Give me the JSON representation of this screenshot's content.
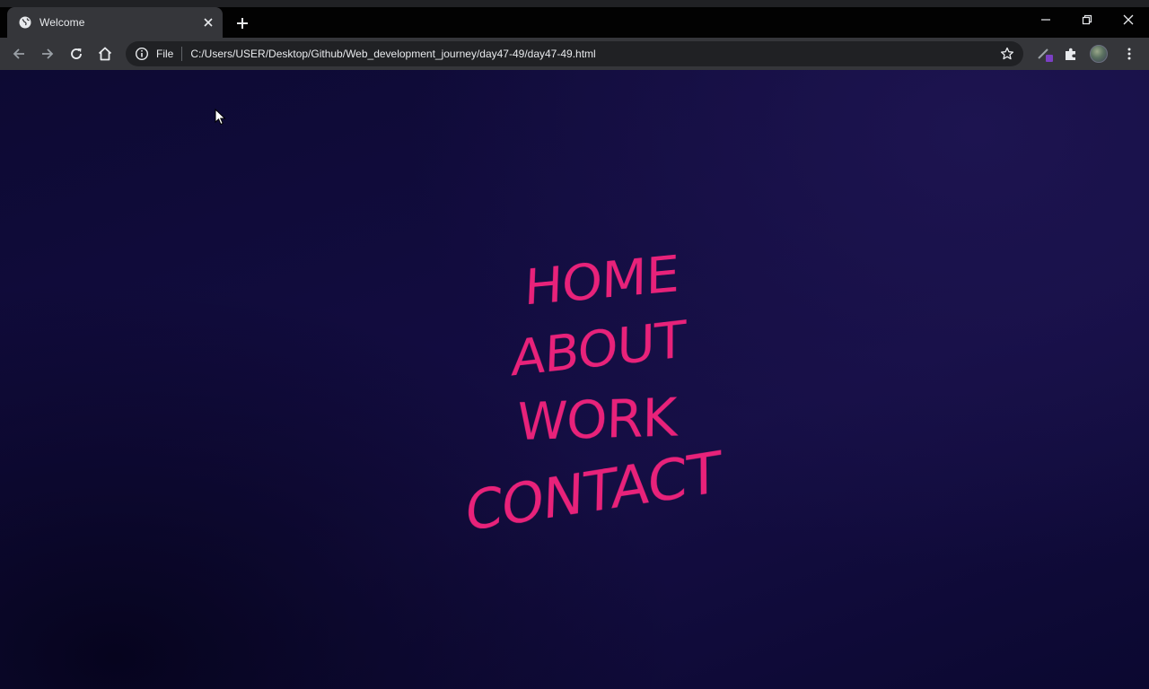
{
  "browser": {
    "tab": {
      "title": "Welcome"
    },
    "omnibox": {
      "scheme_label": "File",
      "url": "C:/Users/USER/Desktop/Github/Web_development_journey/day47-49/day47-49.html"
    }
  },
  "page": {
    "menu": [
      {
        "label": "HOME"
      },
      {
        "label": "ABOUT"
      },
      {
        "label": "WORK"
      },
      {
        "label": "CONTACT"
      }
    ]
  },
  "colors": {
    "menu_text": "#e8227a",
    "background_dark": "#0d0a33",
    "background_light": "#1d1450",
    "chrome_bar": "#35363a",
    "chrome_dark": "#020202"
  },
  "icons": [
    "globe-icon",
    "close-icon",
    "plus-icon",
    "minimize-icon",
    "restore-icon",
    "window-close-icon",
    "back-arrow-icon",
    "forward-arrow-icon",
    "reload-icon",
    "home-icon",
    "info-icon",
    "star-icon",
    "pen-extension-icon",
    "puzzle-icon",
    "kebab-menu-icon",
    "mouse-cursor-icon"
  ]
}
